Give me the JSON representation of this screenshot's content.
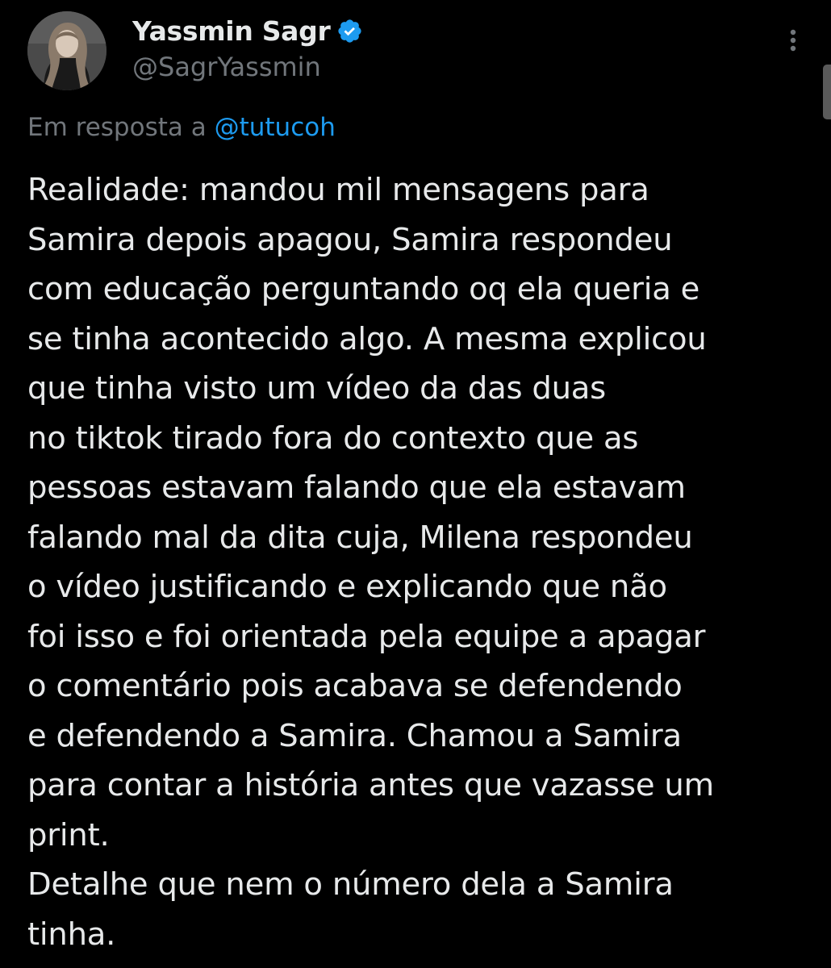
{
  "tweet": {
    "author": {
      "display_name": "Yassmin Sagr",
      "handle": "@SagrYassmin",
      "verified": true,
      "avatar_icon": "profile-photo"
    },
    "reply_to": {
      "prefix": "Em resposta a",
      "mention": "@tutucoh"
    },
    "body": "Realidade: mandou mil mensagens para\nSamira depois apagou, Samira respondeu\ncom educação perguntando oq ela queria e\nse tinha acontecido algo. A mesma explicou\nque tinha visto um vídeo da das duas\nno tiktok tirado fora do contexto que as\npessoas estavam falando que ela estavam\nfalando mal da dita cuja, Milena respondeu\no vídeo justificando e explicando que não\nfoi isso e foi orientada pela equipe a apagar\no comentário pois acabava se defendendo\ne defendendo a Samira. Chamou a Samira\npara contar a história antes que vazasse um\nprint.\nDetalhe que nem o número dela a Samira\ntinha.",
    "more_icon": "more-vertical-icon"
  },
  "colors": {
    "background": "#000000",
    "text_primary": "#e7e9ea",
    "text_secondary": "#71767b",
    "accent": "#1d9bf0"
  }
}
